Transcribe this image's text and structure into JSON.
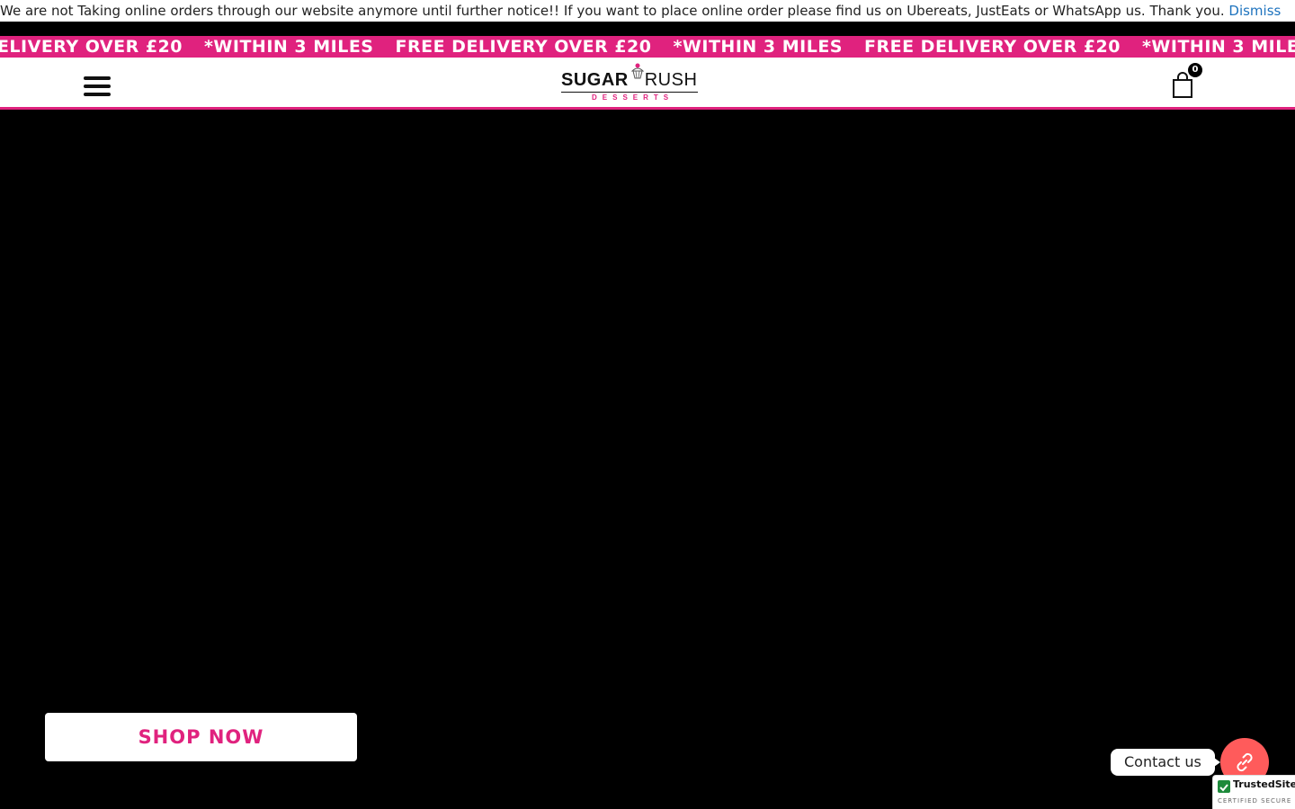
{
  "notice": {
    "text": "We are not Taking online orders through our website anymore until further notice!! If you want to place online order please find us on Ubereats, JustEats or WhatsApp us. Thank you.",
    "dismiss": "Dismiss"
  },
  "ticker": {
    "items": [
      "FREE DELIVERY OVER £20",
      "*WITHIN 3 MILES",
      "FREE DELIVERY OVER £20",
      "*WITHIN 3 MILES",
      "FREE DELIVERY OVER £20",
      "*WITHIN 3 MILES"
    ]
  },
  "header": {
    "logo_bold": "SUGAR",
    "logo_light": "RUSH",
    "logo_sub": "DESSERTS",
    "cart_count": "0"
  },
  "hero": {
    "cta_label": "SHOP NOW"
  },
  "contact": {
    "label": "Contact us"
  },
  "trust": {
    "name": "TrustedSite",
    "sub": "CERTIFIED SECURE"
  },
  "colors": {
    "brand_pink": "#e0227e",
    "contact_red": "#ff5b5b",
    "link_blue": "#1e73be"
  }
}
